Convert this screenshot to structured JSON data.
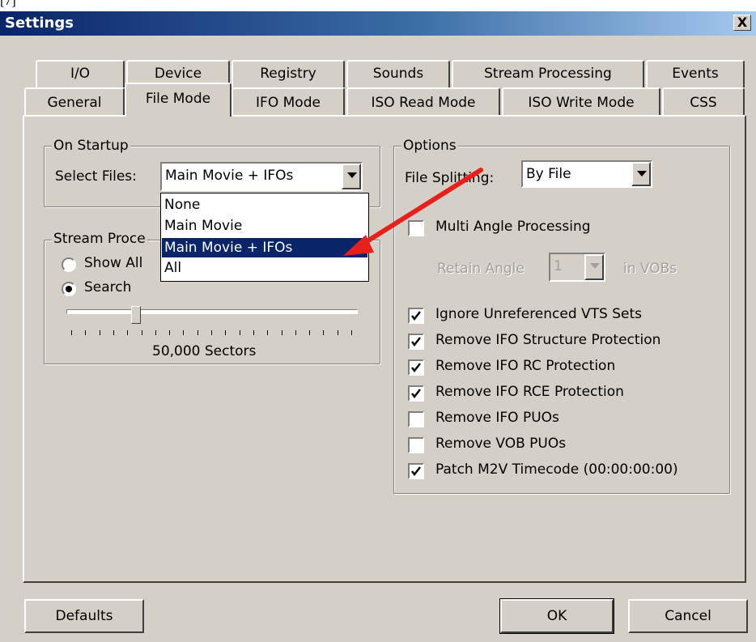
{
  "window": {
    "title": "Settings",
    "close_symbol": "X"
  },
  "tabs_row1": [
    {
      "label": "I/O"
    },
    {
      "label": "Device"
    },
    {
      "label": "Registry"
    },
    {
      "label": "Sounds"
    },
    {
      "label": "Stream Processing"
    },
    {
      "label": "Events"
    }
  ],
  "tabs_row2": [
    {
      "label": "General"
    },
    {
      "label": "File Mode"
    },
    {
      "label": "IFO Mode"
    },
    {
      "label": "ISO Read Mode"
    },
    {
      "label": "ISO Write Mode"
    },
    {
      "label": "CSS"
    }
  ],
  "active_tab": "File Mode",
  "on_startup": {
    "legend": "On Startup",
    "select_files_label": "Select Files:",
    "select_files_value": "Main Movie + IFOs",
    "dropdown_options": [
      "None",
      "Main Movie",
      "Main Movie + IFOs",
      "All"
    ],
    "selected_option": "Main Movie + IFOs"
  },
  "stream_processing": {
    "legend": "Stream Proce",
    "show_all_label": "Show All",
    "search_label": "Search",
    "selected_radio": "Search",
    "slider_caption": "50,000 Sectors",
    "slider_fraction": 0.23
  },
  "options": {
    "legend": "Options",
    "file_splitting_label": "File Splitting:",
    "file_splitting_value": "By File",
    "multi_angle_label": "Multi Angle Processing",
    "multi_angle_checked": false,
    "retain_angle_label": "Retain Angle",
    "retain_angle_value": "1",
    "in_vobs_label": "in VOBs",
    "checkboxes": [
      {
        "label": "Ignore Unreferenced VTS Sets",
        "checked": true
      },
      {
        "label": "Remove IFO Structure Protection",
        "checked": true
      },
      {
        "label": "Remove IFO RC Protection",
        "checked": true
      },
      {
        "label": "Remove IFO RCE Protection",
        "checked": true
      },
      {
        "label": "Remove IFO PUOs",
        "checked": false
      },
      {
        "label": "Remove VOB PUOs",
        "checked": false
      },
      {
        "label": "Patch M2V Timecode (00:00:00:00)",
        "checked": true
      }
    ]
  },
  "buttons": {
    "defaults": "Defaults",
    "ok": "OK",
    "cancel": "Cancel"
  },
  "annotation_color": "#e8201c"
}
